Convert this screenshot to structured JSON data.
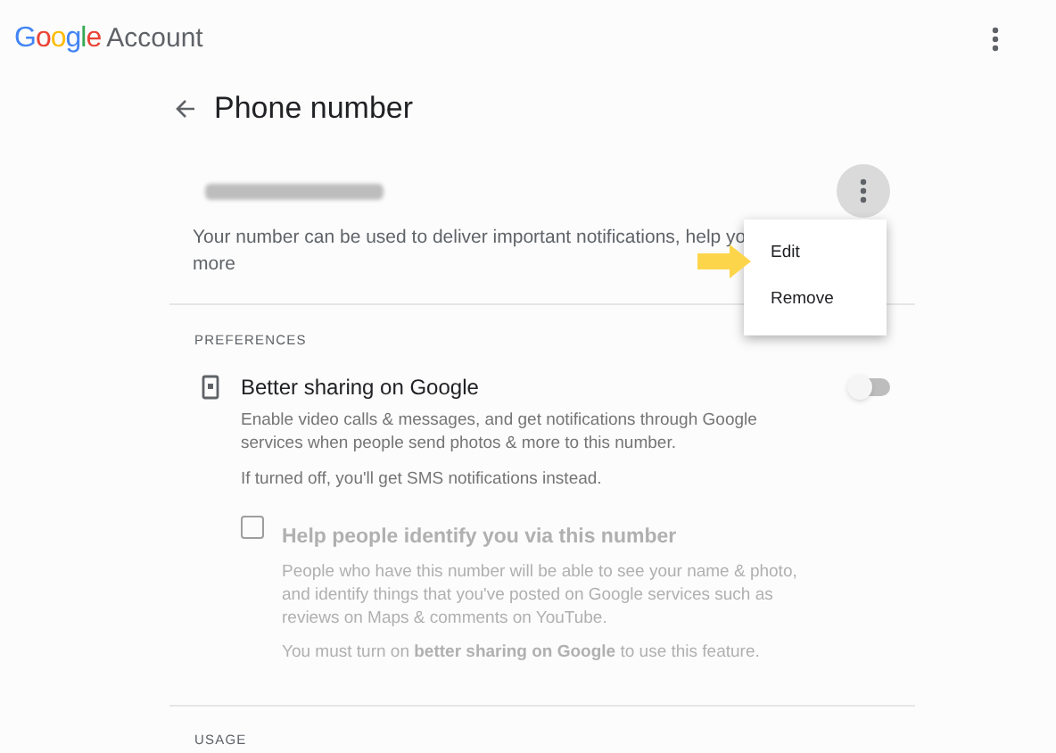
{
  "header": {
    "logo": [
      {
        "letter": "G",
        "color": "#4285f4"
      },
      {
        "letter": "o",
        "color": "#ea4335"
      },
      {
        "letter": "o",
        "color": "#fbbc05"
      },
      {
        "letter": "g",
        "color": "#4285f4"
      },
      {
        "letter": "l",
        "color": "#34a853"
      },
      {
        "letter": "e",
        "color": "#ea4335"
      }
    ],
    "product": "Account"
  },
  "page": {
    "title": "Phone number"
  },
  "phone": {
    "description_lines": [
      "Your number can be used to deliver important notifications, help yo",
      "more"
    ]
  },
  "menu": {
    "open": true,
    "items": [
      "Edit",
      "Remove"
    ]
  },
  "preferences": {
    "heading": "PREFERENCES",
    "setting": {
      "title": "Better sharing on Google",
      "description": "Enable video calls & messages, and get notifications through Google services when people send photos & more to this number.",
      "note": "If turned off, you'll get SMS notifications instead.",
      "on": false
    },
    "option": {
      "title": "Help people identify you via this number",
      "description": "People who have this number will be able to see your name & photo, and identify things that you've posted on Google services such as reviews on Maps & comments on YouTube.",
      "note": "You must turn on **better sharing on Google** to use this feature.",
      "checked": false,
      "disabled": true
    }
  },
  "usage": {
    "heading": "USAGE"
  }
}
